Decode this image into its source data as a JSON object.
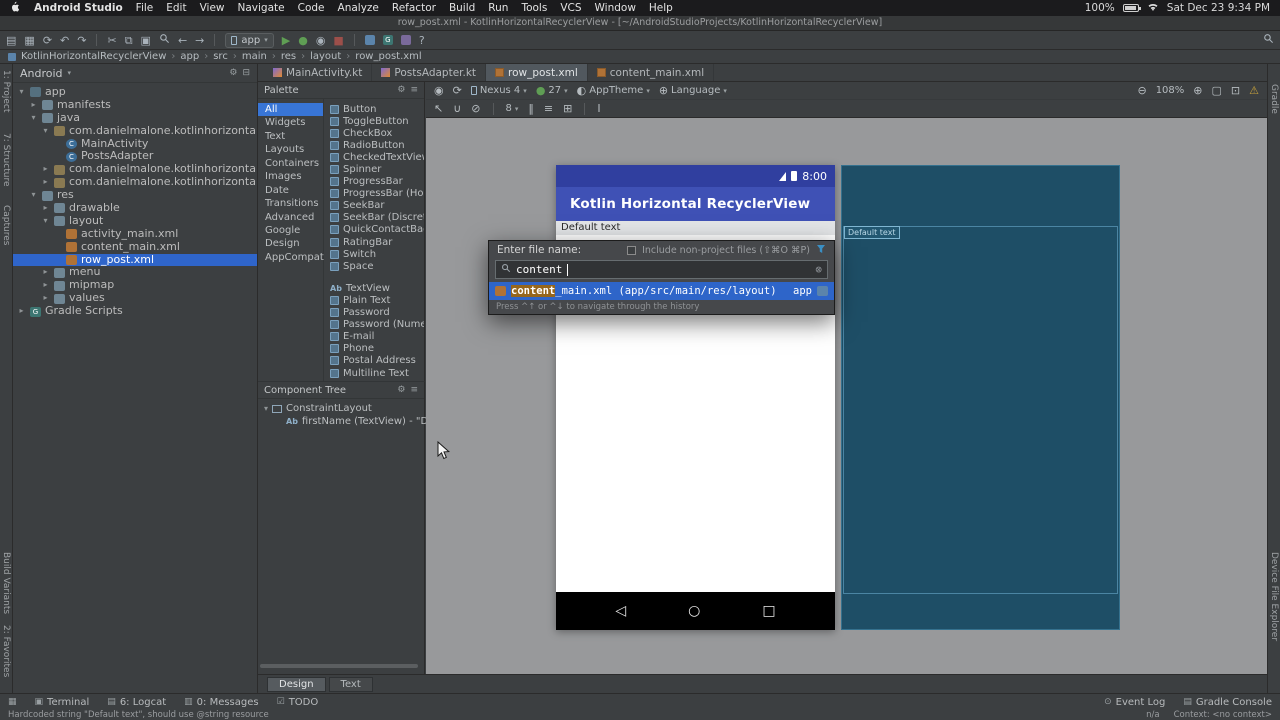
{
  "menubar": {
    "app_name": "Android Studio",
    "items": [
      "File",
      "Edit",
      "View",
      "Navigate",
      "Code",
      "Analyze",
      "Refactor",
      "Build",
      "Run",
      "Tools",
      "VCS",
      "Window",
      "Help"
    ],
    "battery_pct": "100%",
    "clock": "Sat Dec 23 9:34 PM"
  },
  "window_title": "row_post.xml - KotlinHorizontalRecyclerView - [~/AndroidStudioProjects/KotlinHorizontalRecyclerView]",
  "main_toolbar": {
    "run_config": "app"
  },
  "breadcrumbs": [
    "KotlinHorizontalRecyclerView",
    "app",
    "src",
    "main",
    "res",
    "layout",
    "row_post.xml"
  ],
  "tool_strips": {
    "left_top": [
      "1: Project",
      "7: Structure",
      "Captures"
    ],
    "left_bottom": [
      "Build Variants",
      "2: Favorites"
    ],
    "right_top": [
      "Gradle"
    ],
    "right_bottom": [
      "Device File Explorer"
    ]
  },
  "project_panel": {
    "view_selector": "Android",
    "tree": [
      "app",
      "manifests",
      "java",
      "com.danielmalone.kotlinhorizontalrecyclerview",
      "MainActivity",
      "PostsAdapter",
      "com.danielmalone.kotlinhorizontalrecyclerview",
      "com.danielmalone.kotlinhorizontalrecyclerview",
      "res",
      "drawable",
      "layout",
      "activity_main.xml",
      "content_main.xml",
      "row_post.xml",
      "menu",
      "mipmap",
      "values",
      "Gradle Scripts"
    ]
  },
  "palette": {
    "title": "Palette",
    "categories": [
      "All",
      "Widgets",
      "Text",
      "Layouts",
      "Containers",
      "Images",
      "Date",
      "Transitions",
      "Advanced",
      "Google",
      "Design",
      "AppCompat"
    ],
    "widgets": [
      "Button",
      "ToggleButton",
      "CheckBox",
      "RadioButton",
      "CheckedTextView",
      "Spinner",
      "ProgressBar",
      "ProgressBar (Hor",
      "SeekBar",
      "SeekBar (Discrete",
      "QuickContactBad",
      "RatingBar",
      "Switch",
      "Space"
    ],
    "text_widgets": [
      "TextView",
      "Plain Text",
      "Password",
      "Password (Numer",
      "E-mail",
      "Phone",
      "Postal Address",
      "Multiline Text"
    ]
  },
  "component_tree": {
    "title": "Component Tree",
    "root": "ConstraintLayout",
    "child": "firstName (TextView) - \"Defa"
  },
  "editor_tabs": [
    "MainActivity.kt",
    "PostsAdapter.kt",
    "row_post.xml",
    "content_main.xml"
  ],
  "design_toolbar": {
    "device": "Nexus 4",
    "api_level": "27",
    "theme": "AppTheme",
    "language": "Language",
    "zoom": "108%",
    "default_margin": "8"
  },
  "preview": {
    "status_time": "8:00",
    "app_title": "Kotlin Horizontal RecyclerView",
    "content_text": "Default text",
    "blueprint_label": "Default text"
  },
  "popup": {
    "title": "Enter file name:",
    "checkbox_label": "Include non-project files (⇧⌘O ⌘P)",
    "query": "content",
    "result_match": "content",
    "result_rest": "_main.xml (app/src/main/res/layout)",
    "result_module": "app",
    "hint": "Press ^↑ or ^↓ to navigate through the history"
  },
  "bottom_tabs": [
    "Design",
    "Text"
  ],
  "bottom_toolbar": {
    "left": [
      "Terminal",
      "6: Logcat",
      "0: Messages",
      "TODO"
    ],
    "right": [
      "Event Log",
      "Gradle Console"
    ]
  },
  "status_bar": {
    "message": "Hardcoded string \"Default text\", should use @string resource",
    "na": "n/a",
    "context": "Context: <no context>"
  },
  "colors": {
    "appbar_blue": "#3f51b5",
    "statusbar_blue": "#303f9f",
    "selection_blue": "#2f65ca",
    "blueprint_bg": "#1e4e66"
  }
}
